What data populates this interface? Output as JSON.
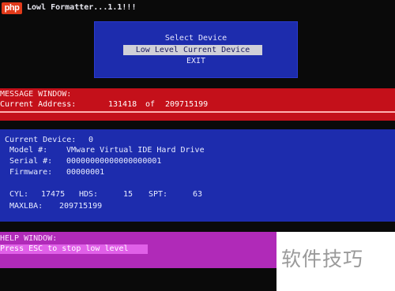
{
  "app": {
    "logo": "php",
    "title": "Lowl Formatter...1.1!!!"
  },
  "menu": {
    "header": "Select Device",
    "items": [
      {
        "label": "Low Level Current Device",
        "selected": true
      },
      {
        "label": "EXIT",
        "selected": false
      }
    ]
  },
  "message_window": {
    "title": "MESSAGE WINDOW:",
    "address_label": "Current Address:",
    "address_value": "131418",
    "of_label": "of",
    "max_value": "209715199"
  },
  "device": {
    "current_label": "Current Device:",
    "current_value": "0",
    "model_label": "Model #:",
    "model_value": "VMware Virtual IDE Hard Drive",
    "serial_label": "Serial #:",
    "serial_value": "00000000000000000001",
    "firmware_label": "Firmware:",
    "firmware_value": "00000001",
    "cyl_label": "CYL:",
    "cyl_value": "17475",
    "hds_label": "HDS:",
    "hds_value": "15",
    "spt_label": "SPT:",
    "spt_value": "63",
    "maxlba_label": "MAXLBA:",
    "maxlba_value": "209715199"
  },
  "help_window": {
    "title": "HELP WINDOW:",
    "text": "Press ESC to stop low level"
  },
  "watermark": {
    "text": "软件技巧"
  },
  "colors": {
    "screen_bg": "#0a0a0a",
    "menu_bg": "#1d2cad",
    "menu_highlight": "#d0d0d8",
    "message_bg": "#c4101a",
    "device_bg": "#1d2cad",
    "help_bg": "#b02ab8",
    "help_highlight": "#e060e8"
  }
}
